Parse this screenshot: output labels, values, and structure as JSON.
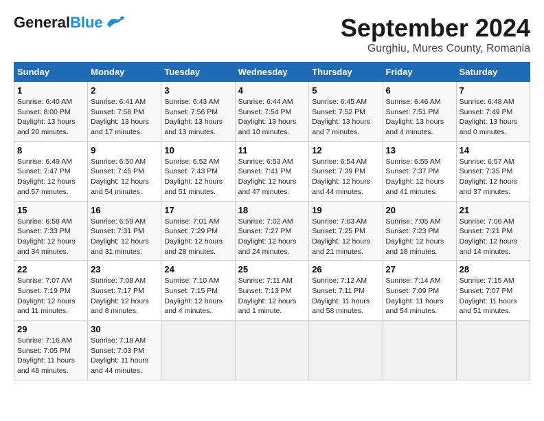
{
  "header": {
    "logo_general": "General",
    "logo_blue": "Blue",
    "title": "September 2024",
    "subtitle": "Gurghiu, Mures County, Romania"
  },
  "calendar": {
    "headers": [
      "Sunday",
      "Monday",
      "Tuesday",
      "Wednesday",
      "Thursday",
      "Friday",
      "Saturday"
    ],
    "weeks": [
      [
        null,
        null,
        null,
        null,
        null,
        null,
        {
          "day": "7",
          "sunrise": "Sunrise: 6:48 AM",
          "sunset": "Sunset: 7:49 PM",
          "daylight": "Daylight: 13 hours and 0 minutes."
        }
      ],
      [
        {
          "day": "1",
          "sunrise": "Sunrise: 6:40 AM",
          "sunset": "Sunset: 8:00 PM",
          "daylight": "Daylight: 13 hours and 20 minutes."
        },
        {
          "day": "2",
          "sunrise": "Sunrise: 6:41 AM",
          "sunset": "Sunset: 7:58 PM",
          "daylight": "Daylight: 13 hours and 17 minutes."
        },
        {
          "day": "3",
          "sunrise": "Sunrise: 6:43 AM",
          "sunset": "Sunset: 7:56 PM",
          "daylight": "Daylight: 13 hours and 13 minutes."
        },
        {
          "day": "4",
          "sunrise": "Sunrise: 6:44 AM",
          "sunset": "Sunset: 7:54 PM",
          "daylight": "Daylight: 13 hours and 10 minutes."
        },
        {
          "day": "5",
          "sunrise": "Sunrise: 6:45 AM",
          "sunset": "Sunset: 7:52 PM",
          "daylight": "Daylight: 13 hours and 7 minutes."
        },
        {
          "day": "6",
          "sunrise": "Sunrise: 6:46 AM",
          "sunset": "Sunset: 7:51 PM",
          "daylight": "Daylight: 13 hours and 4 minutes."
        },
        {
          "day": "7",
          "sunrise": "Sunrise: 6:48 AM",
          "sunset": "Sunset: 7:49 PM",
          "daylight": "Daylight: 13 hours and 0 minutes."
        }
      ],
      [
        {
          "day": "8",
          "sunrise": "Sunrise: 6:49 AM",
          "sunset": "Sunset: 7:47 PM",
          "daylight": "Daylight: 12 hours and 57 minutes."
        },
        {
          "day": "9",
          "sunrise": "Sunrise: 6:50 AM",
          "sunset": "Sunset: 7:45 PM",
          "daylight": "Daylight: 12 hours and 54 minutes."
        },
        {
          "day": "10",
          "sunrise": "Sunrise: 6:52 AM",
          "sunset": "Sunset: 7:43 PM",
          "daylight": "Daylight: 12 hours and 51 minutes."
        },
        {
          "day": "11",
          "sunrise": "Sunrise: 6:53 AM",
          "sunset": "Sunset: 7:41 PM",
          "daylight": "Daylight: 12 hours and 47 minutes."
        },
        {
          "day": "12",
          "sunrise": "Sunrise: 6:54 AM",
          "sunset": "Sunset: 7:39 PM",
          "daylight": "Daylight: 12 hours and 44 minutes."
        },
        {
          "day": "13",
          "sunrise": "Sunrise: 6:55 AM",
          "sunset": "Sunset: 7:37 PM",
          "daylight": "Daylight: 12 hours and 41 minutes."
        },
        {
          "day": "14",
          "sunrise": "Sunrise: 6:57 AM",
          "sunset": "Sunset: 7:35 PM",
          "daylight": "Daylight: 12 hours and 37 minutes."
        }
      ],
      [
        {
          "day": "15",
          "sunrise": "Sunrise: 6:58 AM",
          "sunset": "Sunset: 7:33 PM",
          "daylight": "Daylight: 12 hours and 34 minutes."
        },
        {
          "day": "16",
          "sunrise": "Sunrise: 6:59 AM",
          "sunset": "Sunset: 7:31 PM",
          "daylight": "Daylight: 12 hours and 31 minutes."
        },
        {
          "day": "17",
          "sunrise": "Sunrise: 7:01 AM",
          "sunset": "Sunset: 7:29 PM",
          "daylight": "Daylight: 12 hours and 28 minutes."
        },
        {
          "day": "18",
          "sunrise": "Sunrise: 7:02 AM",
          "sunset": "Sunset: 7:27 PM",
          "daylight": "Daylight: 12 hours and 24 minutes."
        },
        {
          "day": "19",
          "sunrise": "Sunrise: 7:03 AM",
          "sunset": "Sunset: 7:25 PM",
          "daylight": "Daylight: 12 hours and 21 minutes."
        },
        {
          "day": "20",
          "sunrise": "Sunrise: 7:05 AM",
          "sunset": "Sunset: 7:23 PM",
          "daylight": "Daylight: 12 hours and 18 minutes."
        },
        {
          "day": "21",
          "sunrise": "Sunrise: 7:06 AM",
          "sunset": "Sunset: 7:21 PM",
          "daylight": "Daylight: 12 hours and 14 minutes."
        }
      ],
      [
        {
          "day": "22",
          "sunrise": "Sunrise: 7:07 AM",
          "sunset": "Sunset: 7:19 PM",
          "daylight": "Daylight: 12 hours and 11 minutes."
        },
        {
          "day": "23",
          "sunrise": "Sunrise: 7:08 AM",
          "sunset": "Sunset: 7:17 PM",
          "daylight": "Daylight: 12 hours and 8 minutes."
        },
        {
          "day": "24",
          "sunrise": "Sunrise: 7:10 AM",
          "sunset": "Sunset: 7:15 PM",
          "daylight": "Daylight: 12 hours and 4 minutes."
        },
        {
          "day": "25",
          "sunrise": "Sunrise: 7:11 AM",
          "sunset": "Sunset: 7:13 PM",
          "daylight": "Daylight: 12 hours and 1 minute."
        },
        {
          "day": "26",
          "sunrise": "Sunrise: 7:12 AM",
          "sunset": "Sunset: 7:11 PM",
          "daylight": "Daylight: 11 hours and 58 minutes."
        },
        {
          "day": "27",
          "sunrise": "Sunrise: 7:14 AM",
          "sunset": "Sunset: 7:09 PM",
          "daylight": "Daylight: 11 hours and 54 minutes."
        },
        {
          "day": "28",
          "sunrise": "Sunrise: 7:15 AM",
          "sunset": "Sunset: 7:07 PM",
          "daylight": "Daylight: 11 hours and 51 minutes."
        }
      ],
      [
        {
          "day": "29",
          "sunrise": "Sunrise: 7:16 AM",
          "sunset": "Sunset: 7:05 PM",
          "daylight": "Daylight: 11 hours and 48 minutes."
        },
        {
          "day": "30",
          "sunrise": "Sunrise: 7:18 AM",
          "sunset": "Sunset: 7:03 PM",
          "daylight": "Daylight: 11 hours and 44 minutes."
        },
        null,
        null,
        null,
        null,
        null
      ]
    ]
  }
}
